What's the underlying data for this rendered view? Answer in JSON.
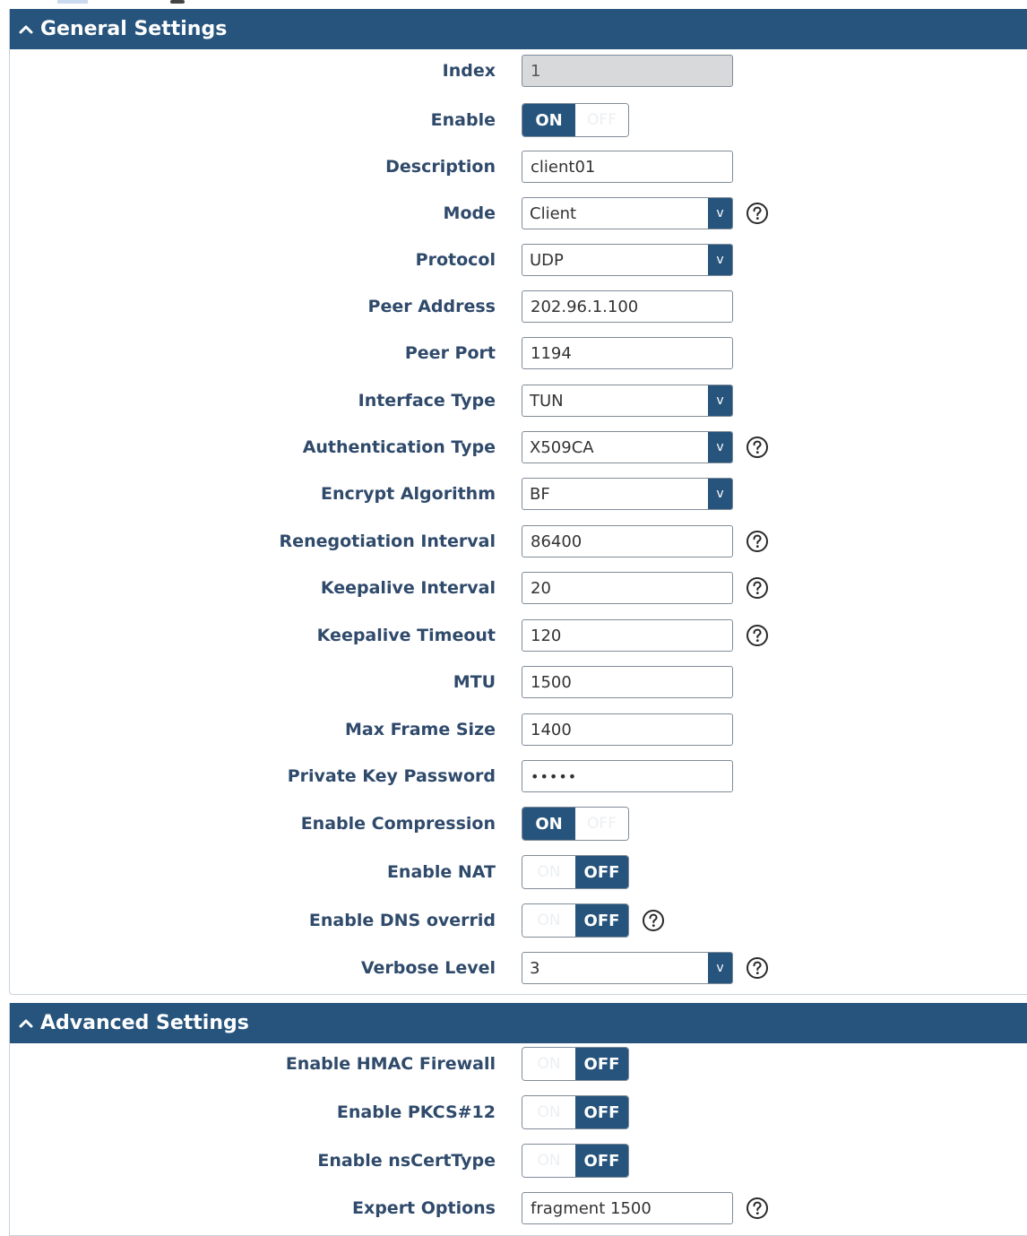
{
  "general": {
    "title": "General Settings",
    "fields": {
      "index": {
        "label": "Index",
        "value": "1"
      },
      "enable": {
        "label": "Enable",
        "state": "ON",
        "on_label": "ON",
        "off_label": "OFF"
      },
      "description": {
        "label": "Description",
        "value": "client01"
      },
      "mode": {
        "label": "Mode",
        "value": "Client"
      },
      "protocol": {
        "label": "Protocol",
        "value": "UDP"
      },
      "peer_address": {
        "label": "Peer Address",
        "value": "202.96.1.100"
      },
      "peer_port": {
        "label": "Peer Port",
        "value": "1194"
      },
      "interface_type": {
        "label": "Interface Type",
        "value": "TUN"
      },
      "auth_type": {
        "label": "Authentication Type",
        "value": "X509CA"
      },
      "encrypt_algorithm": {
        "label": "Encrypt Algorithm",
        "value": "BF"
      },
      "renegotiation_interval": {
        "label": "Renegotiation Interval",
        "value": "86400"
      },
      "keepalive_interval": {
        "label": "Keepalive Interval",
        "value": "20"
      },
      "keepalive_timeout": {
        "label": "Keepalive Timeout",
        "value": "120"
      },
      "mtu": {
        "label": "MTU",
        "value": "1500"
      },
      "max_frame_size": {
        "label": "Max Frame Size",
        "value": "1400"
      },
      "private_key_password": {
        "label": "Private Key Password",
        "value": "•••••"
      },
      "enable_compression": {
        "label": "Enable Compression",
        "state": "ON",
        "on_label": "ON",
        "off_label": "OFF"
      },
      "enable_nat": {
        "label": "Enable NAT",
        "state": "OFF",
        "on_label": "ON",
        "off_label": "OFF"
      },
      "enable_dns_override": {
        "label": "Enable DNS overrid",
        "state": "OFF",
        "on_label": "ON",
        "off_label": "OFF"
      },
      "verbose_level": {
        "label": "Verbose Level",
        "value": "3"
      }
    }
  },
  "advanced": {
    "title": "Advanced Settings",
    "fields": {
      "enable_hmac_firewall": {
        "label": "Enable HMAC Firewall",
        "state": "OFF",
        "on_label": "ON",
        "off_label": "OFF"
      },
      "enable_pkcs12": {
        "label": "Enable PKCS#12",
        "state": "OFF",
        "on_label": "ON",
        "off_label": "OFF"
      },
      "enable_nscerttype": {
        "label": "Enable nsCertType",
        "state": "OFF",
        "on_label": "ON",
        "off_label": "OFF"
      },
      "expert_options": {
        "label": "Expert Options",
        "value": "fragment 1500"
      }
    }
  },
  "select_arrow_glyph": "v",
  "icons": {
    "collapse": "chevron-up-icon",
    "help": "question-circle-icon"
  },
  "colors": {
    "header_bg": "#26547c",
    "label_text": "#2f4a6b",
    "toggle_active": "#26547c",
    "readonly_bg": "#d7d9db"
  }
}
